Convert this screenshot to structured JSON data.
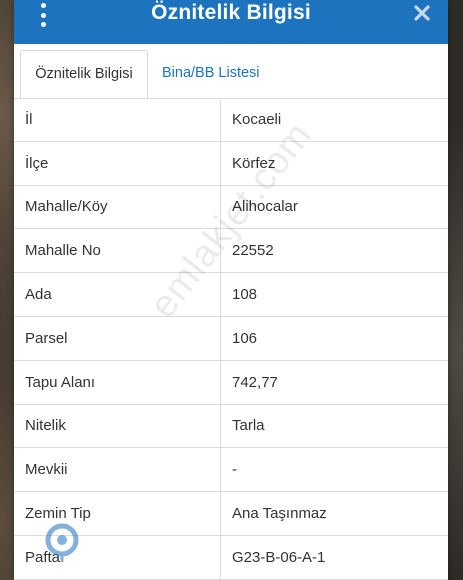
{
  "header": {
    "title": "Öznitelik Bilgisi",
    "menu_icon": "vertical-ellipsis-icon",
    "close_icon": "close-icon"
  },
  "tabs": [
    {
      "label": "Öznitelik Bilgisi",
      "active": true
    },
    {
      "label": "Bina/BB Listesi",
      "active": false
    }
  ],
  "rows": [
    {
      "key": "İl",
      "value": "Kocaeli"
    },
    {
      "key": "İlçe",
      "value": "Körfez"
    },
    {
      "key": "Mahalle/Köy",
      "value": "Alihocalar"
    },
    {
      "key": "Mahalle No",
      "value": "22552"
    },
    {
      "key": "Ada",
      "value": "108"
    },
    {
      "key": "Parsel",
      "value": "106"
    },
    {
      "key": "Tapu Alanı",
      "value": "742,77"
    },
    {
      "key": "Nitelik",
      "value": "Tarla"
    },
    {
      "key": "Mevkii",
      "value": "-"
    },
    {
      "key": "Zemin Tip",
      "value": "Ana Taşınmaz"
    },
    {
      "key": "Pafta",
      "value": "G23-B-06-A-1"
    }
  ],
  "watermark": "emlakjet.com",
  "colors": {
    "header": "#1e73be",
    "link": "#1e73be",
    "text": "#333333",
    "border": "#dcdcdc"
  }
}
